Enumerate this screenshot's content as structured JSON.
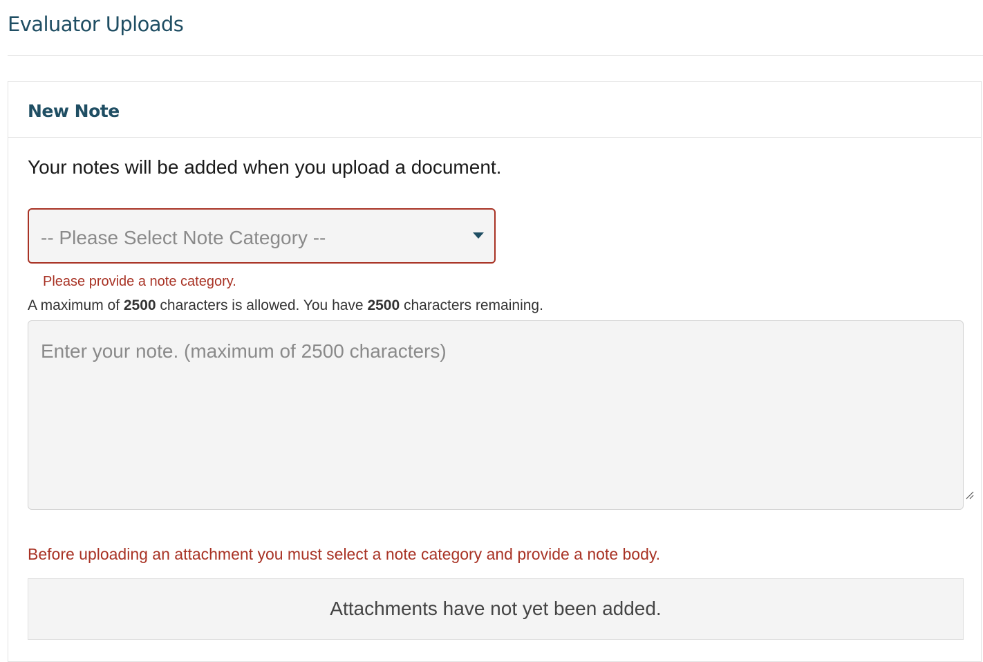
{
  "page": {
    "title": "Evaluator Uploads"
  },
  "card": {
    "title": "New Note",
    "intro": "Your notes will be added when you upload a document."
  },
  "category_select": {
    "placeholder": "-- Please Select Note Category --",
    "error": "Please provide a note category."
  },
  "char_count": {
    "prefix": "A maximum of ",
    "max": "2500",
    "middle": " characters is allowed. You have ",
    "remaining": "2500",
    "suffix": " characters remaining."
  },
  "note_field": {
    "placeholder": "Enter your note. (maximum of 2500 characters)",
    "value": ""
  },
  "attachments": {
    "error": "Before uploading an attachment you must select a note category and provide a note body.",
    "empty_message": "Attachments have not yet been added."
  },
  "colors": {
    "heading": "#1f4e63",
    "error": "#a83224",
    "field_background": "#f4f4f4",
    "placeholder": "#8a8a8a"
  },
  "icons": {
    "select_caret": "caret-down-icon",
    "textarea_resize": "resize-handle-icon"
  }
}
